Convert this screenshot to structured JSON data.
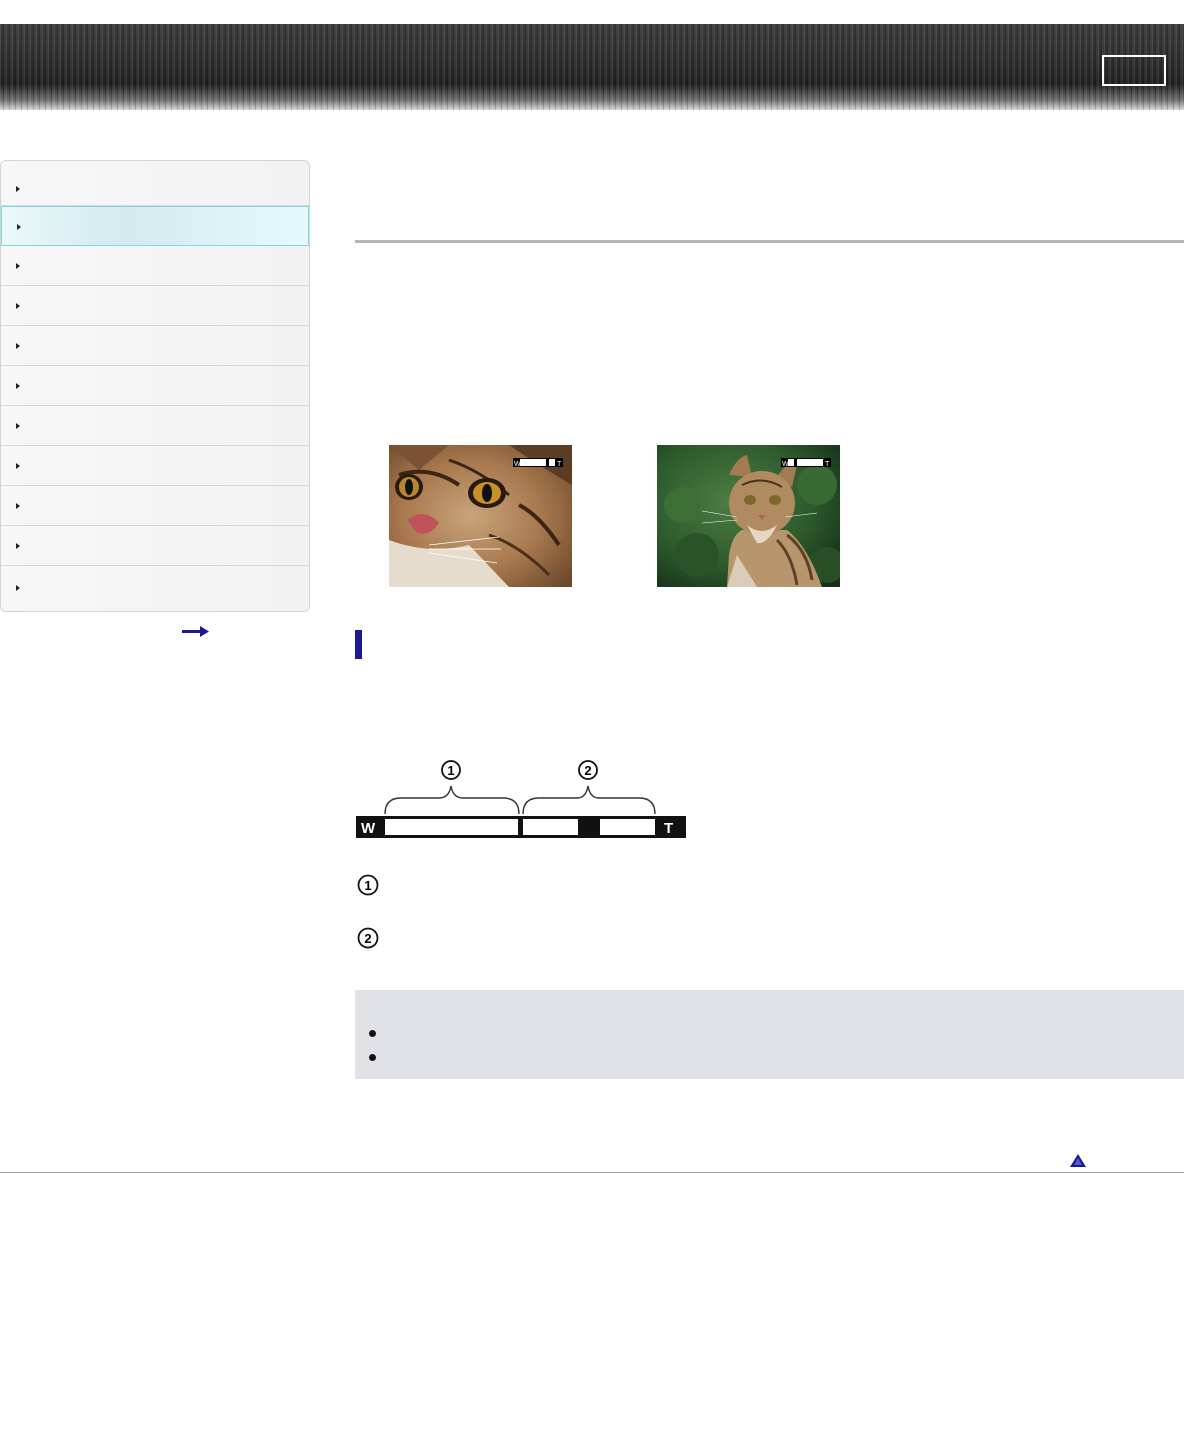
{
  "header": {},
  "sidebar": {
    "items": [
      {
        "label": "",
        "active": false
      },
      {
        "label": "",
        "active": true
      },
      {
        "label": "",
        "active": false
      },
      {
        "label": "",
        "active": false
      },
      {
        "label": "",
        "active": false
      },
      {
        "label": "",
        "active": false
      },
      {
        "label": "",
        "active": false
      },
      {
        "label": "",
        "active": false
      },
      {
        "label": "",
        "active": false
      },
      {
        "label": "",
        "active": false
      },
      {
        "label": "",
        "active": false
      }
    ]
  },
  "main": {
    "title": "",
    "images": [
      {
        "subject": "cat-closeup",
        "zoom_label_w": "W",
        "zoom_label_t": "T"
      },
      {
        "subject": "cat-wide",
        "zoom_label_w": "W",
        "zoom_label_t": "T"
      }
    ],
    "section_heading": "",
    "zoom_bar": {
      "left_label": "W",
      "right_label": "T",
      "markers": [
        "1",
        "2"
      ]
    },
    "legend": [
      {
        "number": "1",
        "text": ""
      },
      {
        "number": "2",
        "text": ""
      }
    ],
    "notes": {
      "title": "",
      "items": [
        "",
        ""
      ]
    }
  },
  "colors": {
    "accent": "#1d1a8f",
    "active_nav": "#7fd6e6",
    "notes_bg": "#e0e2e8"
  },
  "icons": {
    "nav": "triangle-right-icon",
    "more": "arrow-right-icon",
    "top": "triangle-up-icon"
  }
}
